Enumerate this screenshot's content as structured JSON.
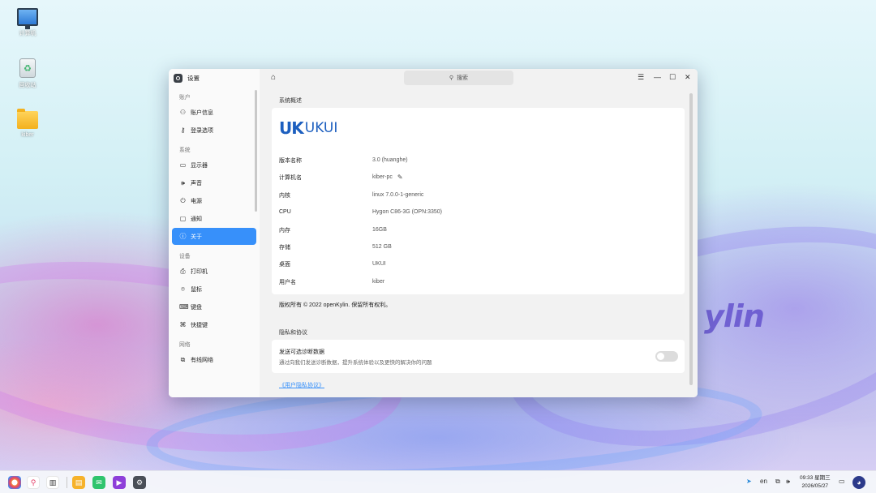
{
  "desktop": {
    "icons": [
      {
        "label": "计算机",
        "icon": "computer-icon"
      },
      {
        "label": "回收站",
        "icon": "trash-icon"
      },
      {
        "label": "kiber",
        "icon": "folder-icon"
      }
    ],
    "wallpaper_text": "ylin"
  },
  "window": {
    "title": "设置",
    "search_placeholder": "搜索",
    "controls": {
      "menu": "☰",
      "minimize": "—",
      "maximize": "☐",
      "close": "✕"
    }
  },
  "sidebar": {
    "groups": [
      {
        "label": "账户",
        "items": [
          {
            "label": "账户信息",
            "icon": "user-icon",
            "glyph": "⚇"
          },
          {
            "label": "登录选项",
            "icon": "key-icon",
            "glyph": "⚷"
          }
        ]
      },
      {
        "label": "系统",
        "items": [
          {
            "label": "显示器",
            "icon": "monitor-icon",
            "glyph": "▭"
          },
          {
            "label": "声音",
            "icon": "speaker-icon",
            "glyph": "🕪"
          },
          {
            "label": "电源",
            "icon": "power-icon",
            "glyph": "⏻"
          },
          {
            "label": "通知",
            "icon": "notification-icon",
            "glyph": "▢"
          },
          {
            "label": "关于",
            "icon": "info-icon",
            "glyph": "ⓘ",
            "active": true
          }
        ]
      },
      {
        "label": "设备",
        "items": [
          {
            "label": "打印机",
            "icon": "printer-icon",
            "glyph": "⎙"
          },
          {
            "label": "鼠标",
            "icon": "mouse-icon",
            "glyph": "⌾"
          },
          {
            "label": "键盘",
            "icon": "keyboard-icon",
            "glyph": "⌨"
          },
          {
            "label": "快捷键",
            "icon": "shortcut-icon",
            "glyph": "⌘"
          }
        ]
      },
      {
        "label": "网络",
        "items": [
          {
            "label": "有线网络",
            "icon": "wired-network-icon",
            "glyph": "⧉"
          }
        ]
      }
    ]
  },
  "about": {
    "section_title": "系统概述",
    "logo": {
      "mark": "UK",
      "text": "UKUI"
    },
    "rows": [
      {
        "key": "版本名称",
        "value": "3.0 (huanghe)"
      },
      {
        "key": "计算机名",
        "value": "kiber-pc",
        "editable": true
      },
      {
        "key": "内核",
        "value": "linux 7.0.0-1-generic"
      },
      {
        "key": "CPU",
        "value": "Hygon C86-3G (OPN:3350)"
      },
      {
        "key": "内存",
        "value": "16GB"
      },
      {
        "key": "存储",
        "value": "512 GB"
      },
      {
        "key": "桌面",
        "value": "UKUI"
      },
      {
        "key": "用户名",
        "value": "kiber"
      }
    ],
    "copyright": "版权所有 © 2022 openKylin. 保留所有权利。",
    "privacy_title": "隐私和协议",
    "diagnostics_title": "发送可选诊断数据",
    "diagnostics_desc": "通过向我们发送诊断数据，提升系统体验以及更快的解决你的问题",
    "diagnostics_enabled": false,
    "privacy_link": "《用户隐私协议》"
  },
  "taskbar": {
    "apps": [
      {
        "icon": "kylin-start-icon",
        "color": "#ffffff"
      },
      {
        "icon": "search-icon",
        "color": "#ffffff"
      },
      {
        "icon": "multitask-icon",
        "color": "#ffffff"
      },
      {
        "icon": "file-manager-icon",
        "color": "#f6b22b"
      },
      {
        "icon": "software-store-icon",
        "color": "#2fc46d"
      },
      {
        "icon": "video-icon",
        "color": "#8e3fd9"
      },
      {
        "icon": "settings-icon",
        "color": "#4a4f57"
      }
    ],
    "tray": {
      "lang": "en",
      "time": "09:33 星期三",
      "date": "2026/05/27"
    }
  },
  "colors": {
    "accent": "#3790fa",
    "brand": "#1d5fbf"
  }
}
